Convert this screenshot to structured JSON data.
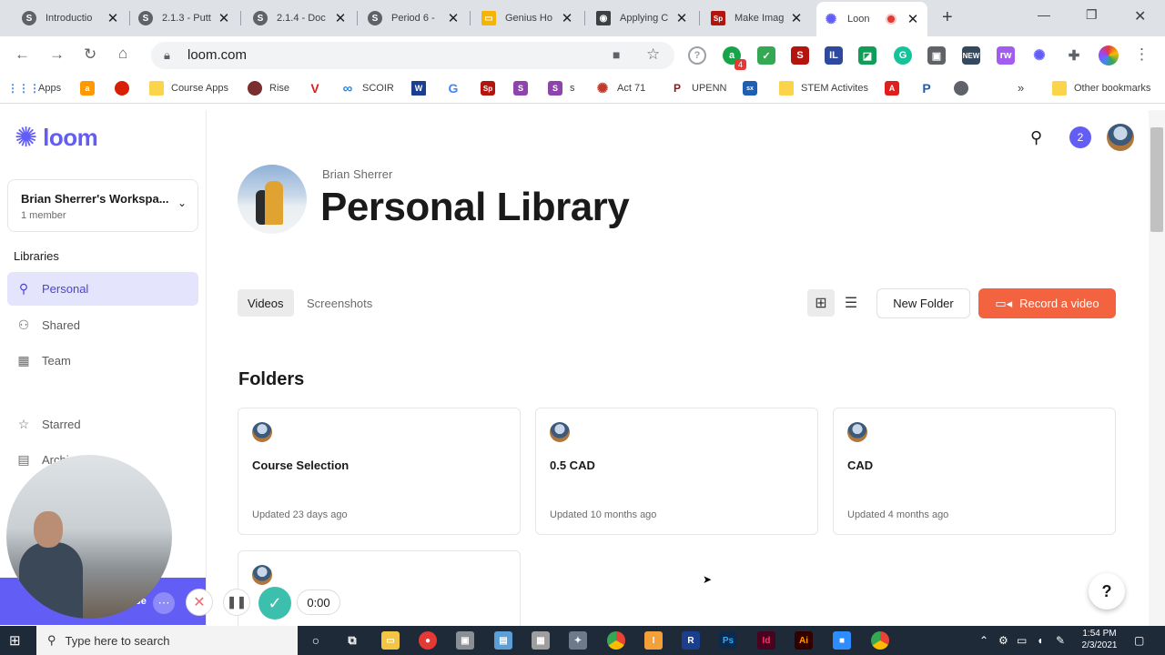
{
  "browser": {
    "tabs": [
      {
        "title": "Introductio",
        "icon": "S",
        "color": "#5f6368"
      },
      {
        "title": "2.1.3 - Putt",
        "icon": "S",
        "color": "#5f6368"
      },
      {
        "title": "2.1.4 - Doc",
        "icon": "S",
        "color": "#5f6368"
      },
      {
        "title": "Period 6 -",
        "icon": "S",
        "color": "#5f6368"
      },
      {
        "title": "Genius Ho",
        "icon": "▭",
        "color": "#f4b400"
      },
      {
        "title": "Applying C",
        "icon": "◉",
        "color": "#3c4043"
      },
      {
        "title": "Make Imag",
        "icon": "Sp",
        "color": "#b3140d"
      },
      {
        "title": "Loon",
        "icon": "✺",
        "color": "#625df5"
      }
    ],
    "url": "loom.com",
    "ext_badge": "4",
    "bookmarks": [
      {
        "label": "Apps",
        "icon": "grid-icon",
        "color": "#ea4335"
      },
      {
        "label": "",
        "icon": "a",
        "color": "#ff9900"
      },
      {
        "label": "",
        "icon": "●",
        "color": "#d81e05"
      },
      {
        "label": "Course Apps",
        "icon": "folder",
        "color": "#fbd449"
      },
      {
        "label": "Rise",
        "icon": "●",
        "color": "#7a2e2e"
      },
      {
        "label": "",
        "icon": "V",
        "color": "#e01e1e"
      },
      {
        "label": "SCOIR",
        "icon": "∞",
        "color": "#1e88e5"
      },
      {
        "label": "",
        "icon": "W",
        "color": "#1a3f8f"
      },
      {
        "label": "",
        "icon": "G",
        "color": "#4285f4"
      },
      {
        "label": "",
        "icon": "Sp",
        "color": "#b3140d"
      },
      {
        "label": "",
        "icon": "S",
        "color": "#8e44ad"
      },
      {
        "label": "s",
        "icon": "S",
        "color": "#8e44ad"
      },
      {
        "label": "Act 71",
        "icon": "✺",
        "color": "#c0392b"
      },
      {
        "label": "UPENN",
        "icon": "P",
        "color": "#8b1a1a"
      },
      {
        "label": "",
        "icon": "sx",
        "color": "#1e5fb4"
      },
      {
        "label": "STEM Activites",
        "icon": "folder",
        "color": "#fbd449"
      },
      {
        "label": "",
        "icon": "A",
        "color": "#e01e1e"
      },
      {
        "label": "",
        "icon": "P",
        "color": "#1e5fb4"
      },
      {
        "label": "",
        "icon": "◍",
        "color": "#5f6368"
      }
    ],
    "other_bookmarks": "Other bookmarks"
  },
  "app": {
    "brand": "loom",
    "workspace": {
      "name": "Brian Sherrer's Workspa...",
      "members": "1 member"
    },
    "libraries_heading": "Libraries",
    "nav": [
      {
        "label": "Personal",
        "icon": "person-icon"
      },
      {
        "label": "Shared",
        "icon": "people-icon"
      },
      {
        "label": "Team",
        "icon": "building-icon"
      },
      {
        "label": "Starred",
        "icon": "star-icon"
      },
      {
        "label": "Archi",
        "icon": "archive-icon"
      }
    ],
    "notification_count": "2",
    "owner": "Brian Sherrer",
    "page_title": "Personal Library",
    "tabs": [
      "Videos",
      "Screenshots"
    ],
    "new_folder_label": "New Folder",
    "record_label": "Record a video",
    "folders_heading": "Folders",
    "folders": [
      {
        "name": "Course Selection",
        "updated": "Updated 23 days ago"
      },
      {
        "name": "0.5 CAD",
        "updated": "Updated 10 months ago"
      },
      {
        "name": "CAD",
        "updated": "Updated 4 months ago"
      },
      {
        "name": "",
        "updated": ""
      }
    ],
    "help_label": "?"
  },
  "recorder": {
    "timer": "0:00",
    "bar_label": "be"
  },
  "taskbar": {
    "search_placeholder": "Type here to search",
    "time": "1:54 PM",
    "date": "2/3/2021"
  }
}
